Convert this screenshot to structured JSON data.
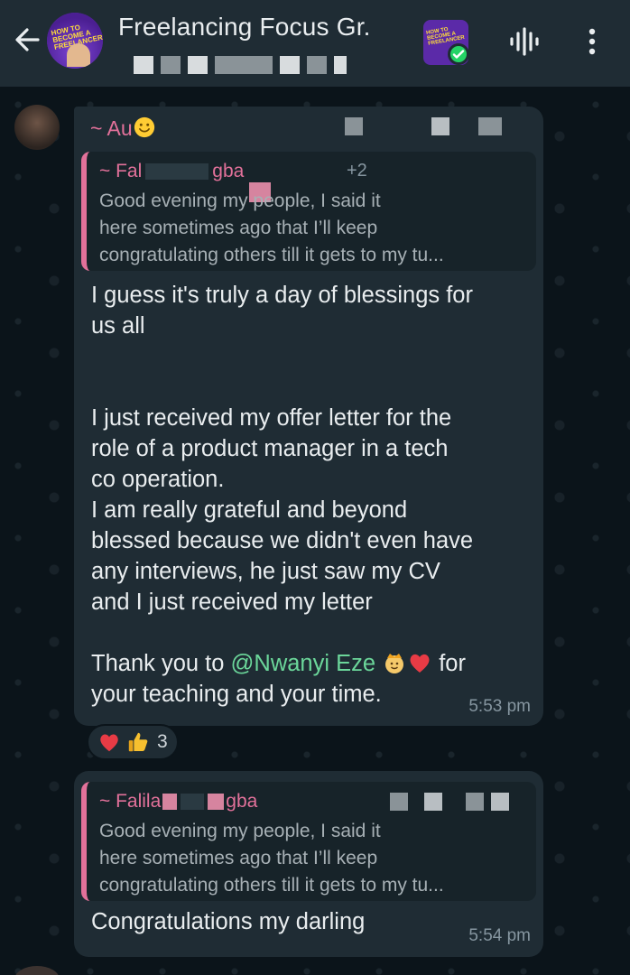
{
  "header": {
    "title": "Freelancing Focus Gr.",
    "group_avatar_text": "HOW TO BECOME A FREELANCER",
    "mini_avatar_text": "HOW TO BECOME A FREELANCER"
  },
  "messages": [
    {
      "sender": "~ Au",
      "quoted": {
        "sender": "~ Fal",
        "sender_tail": "gba",
        "extra": "+2",
        "text": "Good evening my people, I said it\nhere sometimes ago that I’ll keep\ncongratulating others till it gets to my tu..."
      },
      "text_part1": "I guess it's truly a day of blessings for\nus all\n\n\nI just received my offer letter for the\nrole of a product manager in a tech\nco operation.\nI am really grateful and beyond\nblessed because we didn't even have\nany interviews, he just saw my CV\nand I just received my letter\n\n",
      "thank_prefix": "Thank you to ",
      "mention": "@Nwanyi Eze",
      "thank_suffix": "  for\nyour teaching and your time.",
      "time": "5:53 pm",
      "reaction_count": "3"
    },
    {
      "quoted": {
        "sender": "~ Falila",
        "sender_tail": "gba",
        "text": "Good evening my people, I said it\nhere sometimes ago that I’ll keep\ncongratulating others till it gets to my tu..."
      },
      "text": "Congratulations my darling",
      "time": "5:54 pm"
    }
  ]
}
